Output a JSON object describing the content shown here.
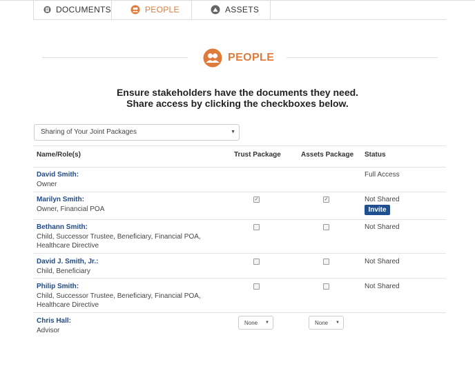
{
  "tabs": [
    {
      "label": "DOCUMENTS",
      "icon": "documents-icon"
    },
    {
      "label": "PEOPLE",
      "icon": "people-icon",
      "active": true
    },
    {
      "label": "ASSETS",
      "icon": "assets-icon"
    }
  ],
  "accent_color": "#e07a3a",
  "link_color": "#214a87",
  "button_color": "#1f4f91",
  "section": {
    "title": "PEOPLE",
    "icon": "people-icon"
  },
  "intro": {
    "line1": "Ensure stakeholders have the documents they need.",
    "line2": "Share access by clicking the checkboxes below."
  },
  "package_select": {
    "value": "Sharing of Your Joint Packages"
  },
  "table": {
    "headers": {
      "name": "Name/Role(s)",
      "trust": "Trust Package",
      "assets": "Assets Package",
      "status": "Status"
    },
    "rows": [
      {
        "name": "David Smith:",
        "role": "Owner",
        "trust": null,
        "assets": null,
        "status": "Full Access"
      },
      {
        "name": "Marilyn Smith:",
        "role": "Owner, Financial POA",
        "trust": true,
        "assets": true,
        "status": "Not Shared",
        "action": "Invite"
      },
      {
        "name": "Bethann Smith:",
        "role_line1": "Child, Successor Trustee, Beneficiary, Financial POA,",
        "role_line2": "Healthcare Directive",
        "trust": false,
        "assets": false,
        "status": "Not Shared"
      },
      {
        "name": "David J. Smith, Jr.:",
        "role": "Child, Beneficiary",
        "trust": false,
        "assets": false,
        "status": "Not Shared"
      },
      {
        "name": "Philip Smith:",
        "role_line1": "Child, Successor Trustee, Beneficiary, Financial POA,",
        "role_line2": "Healthcare Directive",
        "trust": false,
        "assets": false,
        "status": "Not Shared"
      },
      {
        "name": "Chris Hall:",
        "role": "Advisor",
        "trust_select": "None",
        "assets_select": "None",
        "status": ""
      }
    ]
  }
}
